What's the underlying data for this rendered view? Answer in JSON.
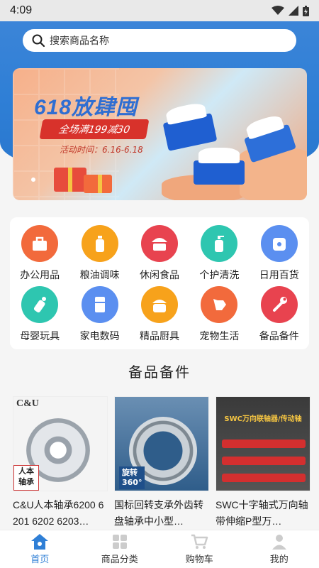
{
  "status": {
    "time": "4:09"
  },
  "search": {
    "placeholder": "搜索商品名称"
  },
  "banner": {
    "title": "618放肆囤",
    "ribbon": "全场满199减30",
    "date": "活动时间：6.16-6.18"
  },
  "categories": [
    {
      "label": "办公用品",
      "icon": "briefcase-icon",
      "color": "#f26a3c"
    },
    {
      "label": "粮油调味",
      "icon": "bottle-icon",
      "color": "#f7a21b"
    },
    {
      "label": "休闲食品",
      "icon": "cake-icon",
      "color": "#e8434f"
    },
    {
      "label": "个护清洗",
      "icon": "pump-bottle-icon",
      "color": "#2ec6b0"
    },
    {
      "label": "日用百货",
      "icon": "tissue-roll-icon",
      "color": "#5b8ff0"
    },
    {
      "label": "母婴玩具",
      "icon": "baby-bottle-icon",
      "color": "#2ec6b0"
    },
    {
      "label": "家电数码",
      "icon": "fridge-icon",
      "color": "#5b8ff0"
    },
    {
      "label": "精品厨具",
      "icon": "rice-cooker-icon",
      "color": "#f7a21b"
    },
    {
      "label": "宠物生活",
      "icon": "dog-icon",
      "color": "#f26a3c"
    },
    {
      "label": "备品备件",
      "icon": "wrench-icon",
      "color": "#e8434f"
    }
  ],
  "section": {
    "title": "备品备件"
  },
  "products": [
    {
      "name": "C&U人本轴承6200 6201 6202 6203…",
      "img_brand": "C&U",
      "img_tag": "人本\n轴承"
    },
    {
      "name": "国标回转支承外齿转盘轴承中小型…",
      "img_tag": "旋转\n360°"
    },
    {
      "name": "SWC十字轴式万向轴 带伸缩P型万…",
      "img_tag": "SWC万向联轴器/传动轴"
    }
  ],
  "nav": [
    {
      "label": "首页",
      "icon": "home-icon",
      "active": true
    },
    {
      "label": "商品分类",
      "icon": "category-icon"
    },
    {
      "label": "购物车",
      "icon": "cart-icon"
    },
    {
      "label": "我的",
      "icon": "user-icon"
    }
  ]
}
